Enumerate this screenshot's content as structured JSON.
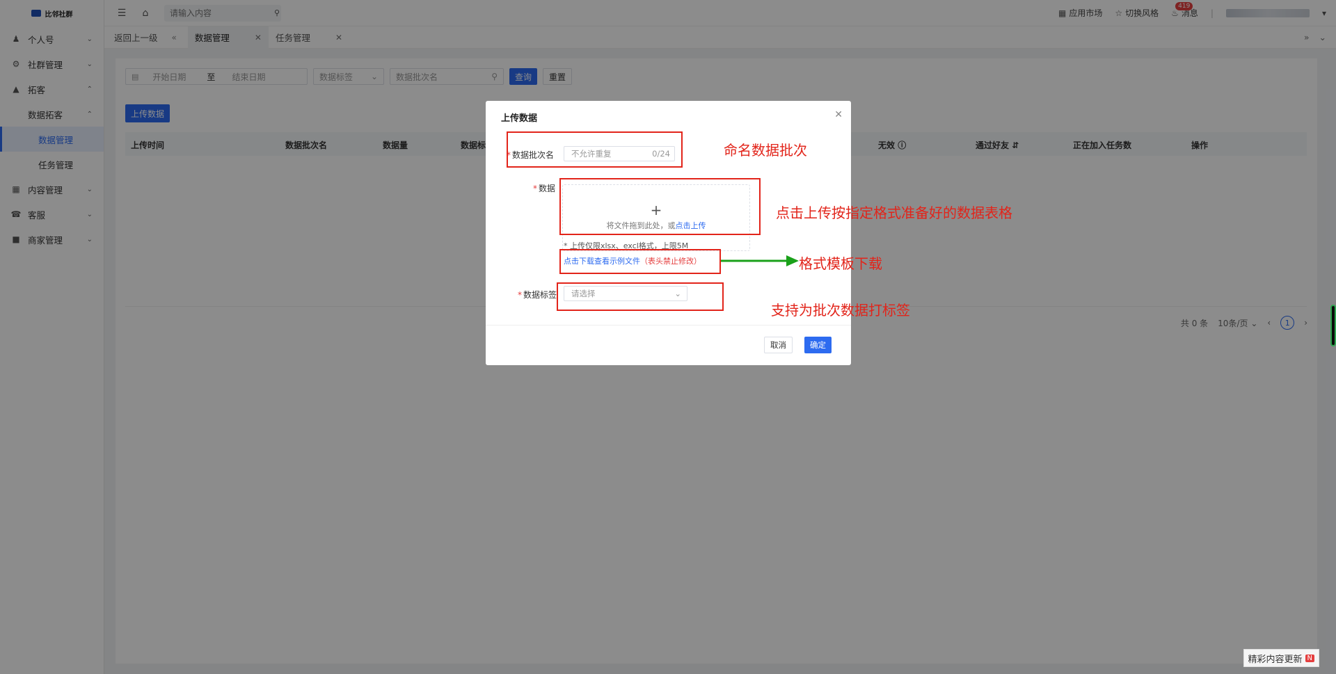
{
  "app": {
    "logo_text": "比邻社群"
  },
  "sidebar": {
    "items": [
      {
        "label": "个人号",
        "icon": "user-icon"
      },
      {
        "label": "社群管理",
        "icon": "gear-icon"
      },
      {
        "label": "拓客",
        "icon": "org-icon"
      },
      {
        "sub_label": "数据拓客"
      },
      {
        "leaf_active": "数据管理"
      },
      {
        "leaf": "任务管理"
      },
      {
        "label": "内容管理",
        "icon": "grid-icon"
      },
      {
        "label": "客服",
        "icon": "headset-icon"
      },
      {
        "label": "商家管理",
        "icon": "store-icon"
      }
    ]
  },
  "header": {
    "search_placeholder": "请输入内容",
    "app_market": "应用市场",
    "switch_style": "切换风格",
    "messages": "消息",
    "msg_count": "419"
  },
  "tabs": {
    "back": "返回上一级",
    "items": [
      "数据管理",
      "任务管理"
    ]
  },
  "filters": {
    "start_date": "开始日期",
    "range_sep": "至",
    "end_date": "结束日期",
    "tag_placeholder": "数据标签",
    "batch_placeholder": "数据批次名",
    "query": "查询",
    "reset": "重置"
  },
  "upload_button": "上传数据",
  "table": {
    "columns": [
      "上传时间",
      "数据批次名",
      "数据量",
      "数据标",
      "无效",
      "通过好友",
      "正在加入任务数",
      "操作"
    ]
  },
  "pager": {
    "total": "共 0 条",
    "page_size": "10条/页",
    "current": "1"
  },
  "modal": {
    "title": "上传数据",
    "batch_label": "数据批次名",
    "batch_placeholder": "不允许重复",
    "batch_counter": "0/24",
    "data_label": "数据",
    "drop_text": "将文件拖到此处，或",
    "drop_link": "点击上传",
    "upload_tip": "* 上传仅限xlsx、excl格式，上限5M",
    "download_link": "点击下载查看示例文件",
    "download_warn": "（表头禁止修改）",
    "tag_label": "数据标签",
    "tag_placeholder": "请选择",
    "cancel": "取消",
    "ok": "确定"
  },
  "annotations": {
    "name_batch": "命名数据批次",
    "upload_hint": "点击上传按指定格式准备好的数据表格",
    "template_download": "格式模板下载",
    "tag_support": "支持为批次数据打标签"
  },
  "watermark": {
    "text": "精彩内容更新",
    "badge": "N"
  },
  "colors": {
    "primary": "#2d6bf0",
    "annotation_red": "#e2241a",
    "arrow_green": "#1aa11a"
  }
}
